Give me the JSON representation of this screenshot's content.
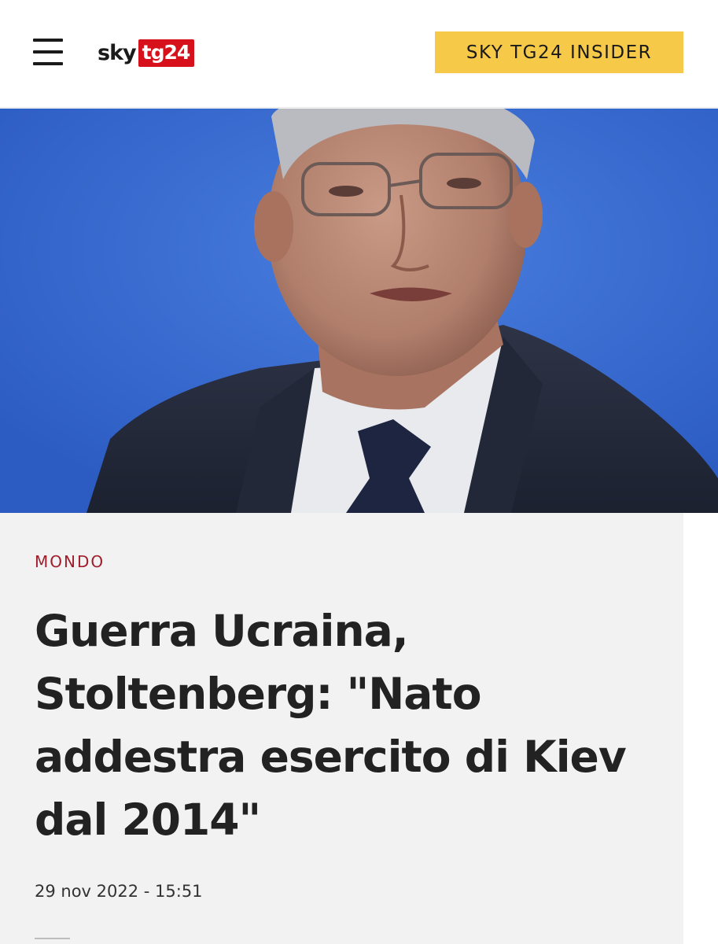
{
  "header": {
    "logo_sky": "sky",
    "logo_tg": "tg24",
    "insider_button": "SKY TG24 INSIDER"
  },
  "hero": {
    "image": "person-at-press-conference"
  },
  "article": {
    "category": "MONDO",
    "title": "Guerra Ucraina, Stoltenberg: \"Nato addestra esercito di Kiev dal 2014\"",
    "timestamp": "29 nov 2022 - 15:51"
  },
  "colors": {
    "brand_red": "#d6111b",
    "insider_yellow": "#f7c948",
    "category_red": "#a01e2c",
    "article_bg": "#f2f2f2",
    "hero_blue": "#3a6fd6"
  },
  "icons": [
    "menu-icon"
  ]
}
